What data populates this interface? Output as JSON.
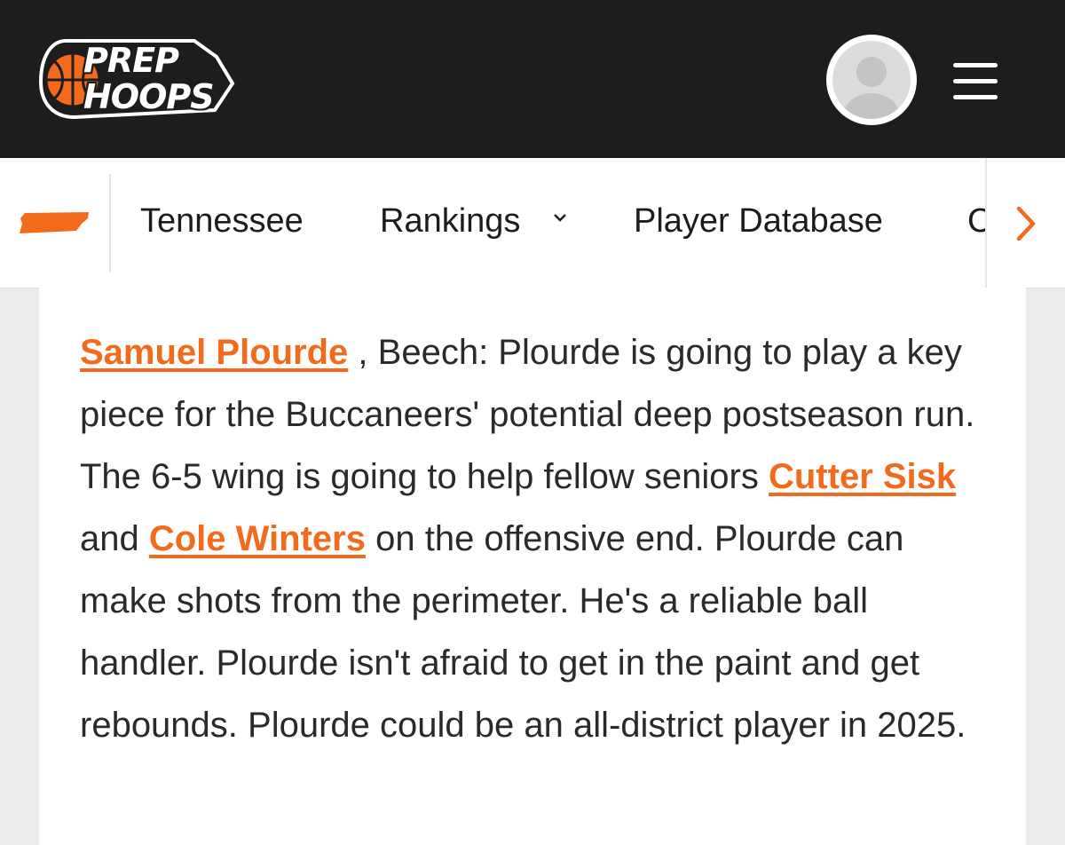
{
  "brand": {
    "logo_line1": "PREP",
    "logo_line2": "HOOPS",
    "accent": "#f26b1d",
    "header_bg": "#1d1d1d"
  },
  "header": {
    "avatar_icon": "user-avatar-icon",
    "menu_icon": "hamburger-menu-icon"
  },
  "nav": {
    "state_icon": "tennessee-state-icon",
    "items": [
      {
        "label": "Tennessee"
      },
      {
        "label": "Rankings",
        "icon": "chevron-down-icon"
      },
      {
        "label": "Player Database"
      },
      {
        "label": "C"
      }
    ],
    "scroll_icon": "chevron-right-icon"
  },
  "article": {
    "player_link": "Samuel Plourde",
    "text_1": " , Beech: Plourde is going to play a key piece for the Buccaneers' potential deep postseason run. The 6-5 wing is going to help fellow seniors ",
    "link_2": "Cutter Sisk",
    "text_2": " and ",
    "link_3": "Cole Winters",
    "text_3": " on the offensive end. Plourde can make shots from the perimeter. He's a reliable ball handler. Plourde isn't afraid to get in the paint and get rebounds. Plourde could be an all-district player in 2025."
  }
}
